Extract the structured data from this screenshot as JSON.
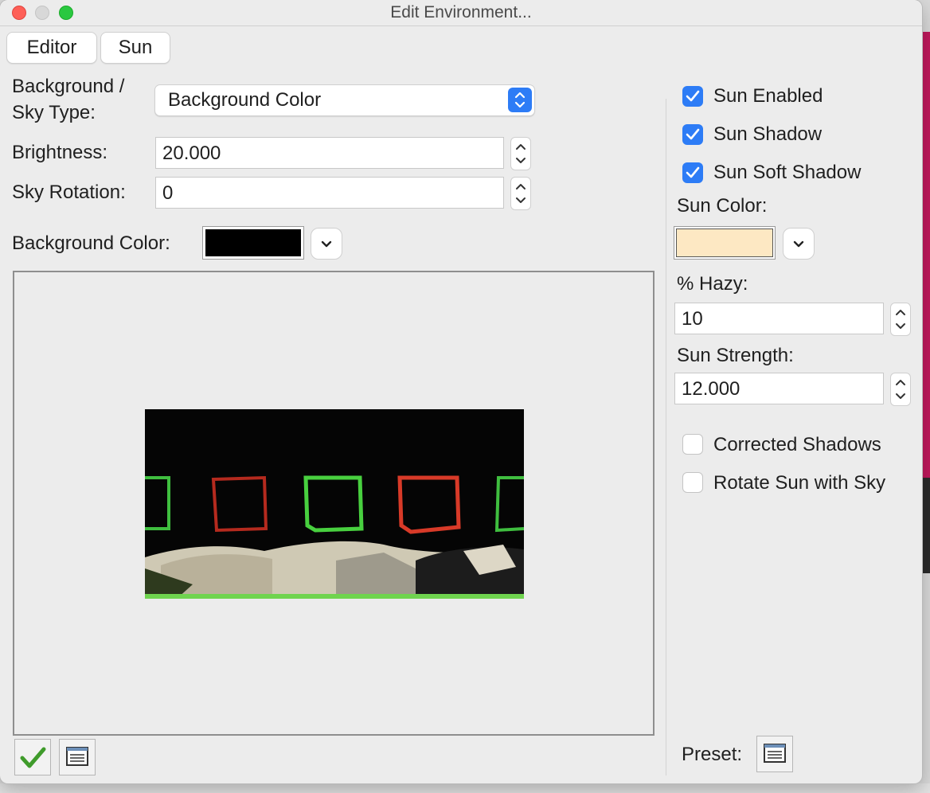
{
  "window": {
    "title": "Edit Environment..."
  },
  "tabs": [
    {
      "label": "Editor"
    },
    {
      "label": "Sun"
    }
  ],
  "editor": {
    "sky_type_label_line1": "Background /",
    "sky_type_label_line2": "Sky Type:",
    "sky_type_value": "Background Color",
    "brightness_label": "Brightness:",
    "brightness_value": "20.000",
    "sky_rotation_label": "Sky Rotation:",
    "sky_rotation_value": "0",
    "background_color_label": "Background Color:",
    "background_color": "#000000"
  },
  "sun": {
    "enabled_label": "Sun Enabled",
    "enabled": true,
    "shadow_label": "Sun Shadow",
    "shadow": true,
    "soft_shadow_label": "Sun Soft Shadow",
    "soft_shadow": true,
    "color_label": "Sun Color:",
    "color": "#fde8c3",
    "hazy_label": "% Hazy:",
    "hazy_value": "10",
    "strength_label": "Sun Strength:",
    "strength_value": "12.000",
    "corrected_shadows_label": "Corrected Shadows",
    "corrected_shadows": false,
    "rotate_with_sky_label": "Rotate Sun with Sky",
    "rotate_with_sky": false,
    "preset_label": "Preset:"
  },
  "icons": {
    "ok": "checkmark-icon",
    "list": "list-icon",
    "checkbox_accent": "#2d7cf6"
  }
}
